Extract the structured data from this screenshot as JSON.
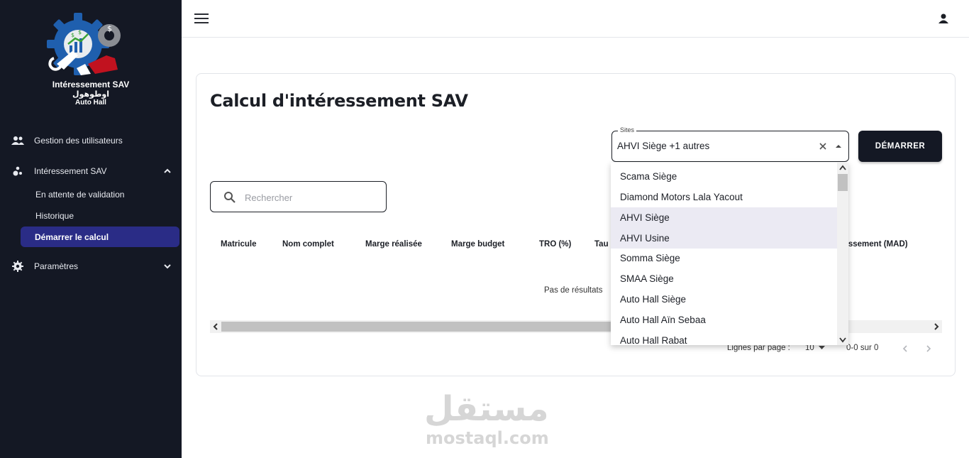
{
  "brand": {
    "title": "Intéressement SAV",
    "arabic": "اوطوهول",
    "subtitle": "Auto Hall"
  },
  "sidebar": {
    "items": [
      {
        "label": "Gestion des utilisateurs",
        "icon": "users-icon"
      },
      {
        "label": "Intéressement SAV",
        "icon": "bubble-chart-icon",
        "expanded": true,
        "children": [
          "En attente de validation",
          "Historique",
          "Démarrer le calcul"
        ]
      },
      {
        "label": "Paramètres",
        "icon": "gear-icon",
        "expanded": false
      }
    ],
    "active_child": "Démarrer le calcul"
  },
  "colors": {
    "sidebar_bg": "#141824",
    "active_bg": "#2a2c86",
    "primary_button": "#141824"
  },
  "main": {
    "title": "Calcul d'intéressement SAV",
    "sites_field": {
      "label": "Sites",
      "value": "AHVI Siège +1 autres"
    },
    "start_button": "DÉMARRER",
    "search": {
      "placeholder": "Rechercher"
    },
    "columns": [
      "Matricule",
      "Nom complet",
      "Marge réalisée",
      "Marge budget",
      "TRO (%)",
      "Tau",
      "ressement (MAD)"
    ],
    "empty_text": "Pas de résultats",
    "pagination": {
      "rows_label": "Lignes par page :",
      "rows_value": "10",
      "range": "0-0 sur 0"
    }
  },
  "dropdown": {
    "options": [
      {
        "label": "Scama Siège",
        "selected": false
      },
      {
        "label": "Diamond Motors Lala Yacout",
        "selected": false
      },
      {
        "label": "AHVI Siège",
        "selected": true
      },
      {
        "label": "AHVI Usine",
        "selected": true
      },
      {
        "label": "Somma Siège",
        "selected": false
      },
      {
        "label": "SMAA Siège",
        "selected": false
      },
      {
        "label": "Auto Hall Siège",
        "selected": false
      },
      {
        "label": "Auto Hall Aïn Sebaa",
        "selected": false
      },
      {
        "label": "Auto Hall Rabat",
        "selected": false
      }
    ]
  },
  "watermark": {
    "arabic": "مستقل",
    "latin": "mostaql.com"
  }
}
